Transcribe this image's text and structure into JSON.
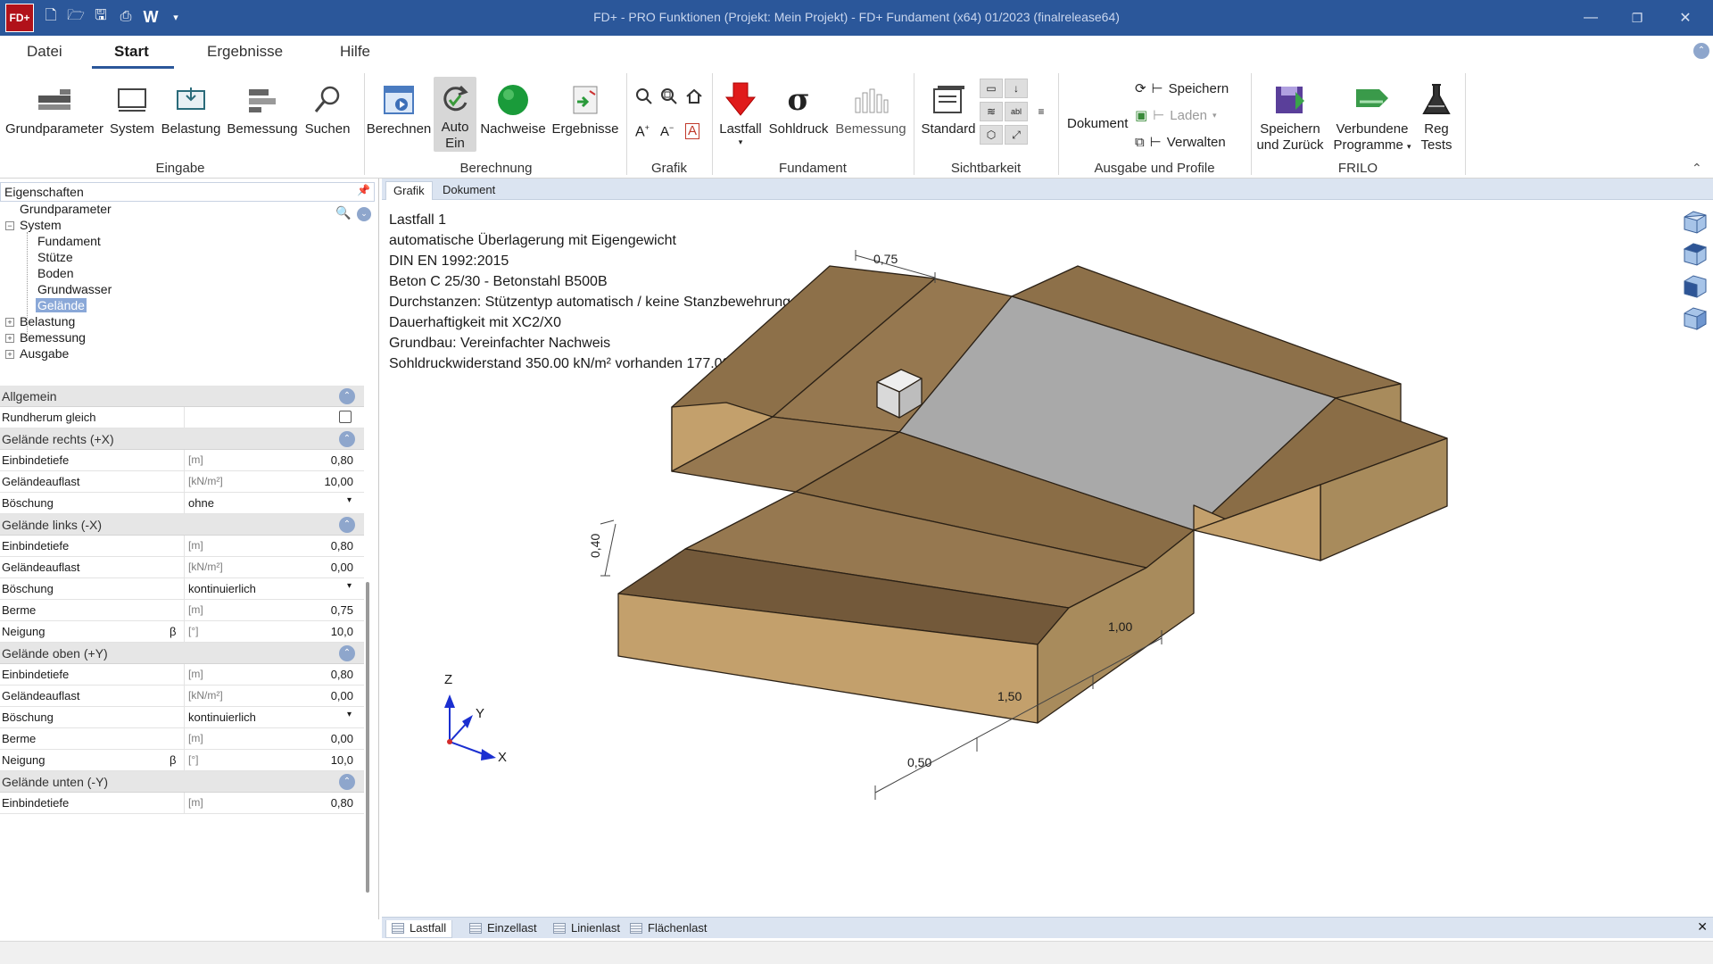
{
  "window": {
    "title": "FD+ - PRO Funktionen (Projekt: Mein Projekt) - FD+ Fundament (x64) 01/2023 (finalrelease64)",
    "logo": "FD+",
    "quick_access": [
      "new-file-icon",
      "open-folder-icon",
      "save-icon",
      "print-icon",
      "W",
      "dropdown"
    ]
  },
  "menu_tabs": [
    {
      "label": "Datei",
      "active": false
    },
    {
      "label": "Start",
      "active": true
    },
    {
      "label": "Ergebnisse",
      "active": false
    },
    {
      "label": "Hilfe",
      "active": false
    }
  ],
  "ribbon": {
    "eingabe": {
      "label": "Eingabe",
      "buttons": [
        "Grundparameter",
        "System",
        "Belastung",
        "Bemessung",
        "Suchen"
      ]
    },
    "berechnung": {
      "label": "Berechnung",
      "berechnen": "Berechnen",
      "auto_line1": "Auto",
      "auto_line2": "Ein",
      "nachweise": "Nachweise",
      "ergebnisse": "Ergebnisse"
    },
    "grafik": {
      "label": "Grafik"
    },
    "fundament": {
      "label": "Fundament",
      "buttons": [
        "Lastfall",
        "Sohldruck",
        "Bemessung"
      ]
    },
    "sichtbarkeit": {
      "label": "Sichtbarkeit",
      "standard": "Standard"
    },
    "ausgabe": {
      "label": "Ausgabe und Profile",
      "dokument": "Dokument",
      "speichern": "Speichern",
      "laden": "Laden",
      "verwalten": "Verwalten"
    },
    "frilo": {
      "label": "FRILO",
      "speichern_l1": "Speichern",
      "speichern_l2": "und Zurück",
      "verbundene_l1": "Verbundene",
      "verbundene_l2": "Programme",
      "reg_l1": "Reg",
      "reg_l2": "Tests"
    }
  },
  "left_panel": {
    "title": "Eigenschaften",
    "tree": [
      {
        "label": "Grundparameter",
        "level": 0
      },
      {
        "label": "System",
        "level": 0,
        "expander": "−"
      },
      {
        "label": "Fundament",
        "level": 1
      },
      {
        "label": "Stütze",
        "level": 1
      },
      {
        "label": "Boden",
        "level": 1
      },
      {
        "label": "Grundwasser",
        "level": 1
      },
      {
        "label": "Gelände",
        "level": 1,
        "selected": true
      },
      {
        "label": "Belastung",
        "level": 0,
        "expander": "+"
      },
      {
        "label": "Bemessung",
        "level": 0,
        "expander": "+"
      },
      {
        "label": "Ausgabe",
        "level": 0,
        "expander": "+"
      }
    ],
    "sections": {
      "allgemein": {
        "title": "Allgemein",
        "rundherum": "Rundherum gleich",
        "checked": false
      },
      "rechts": {
        "title": "Gelände rechts (+X)",
        "einbindetiefe": {
          "label": "Einbindetiefe",
          "unit": "[m]",
          "value": "0,80"
        },
        "auflast": {
          "label": "Geländeauflast",
          "unit": "[kN/m²]",
          "value": "10,00"
        },
        "boeschung": {
          "label": "Böschung",
          "value": "ohne"
        }
      },
      "links": {
        "title": "Gelände links (-X)",
        "einbindetiefe": {
          "label": "Einbindetiefe",
          "unit": "[m]",
          "value": "0,80"
        },
        "auflast": {
          "label": "Geländeauflast",
          "unit": "[kN/m²]",
          "value": "0,00"
        },
        "boeschung": {
          "label": "Böschung",
          "value": "kontinuierlich"
        },
        "berme": {
          "label": "Berme",
          "unit": "[m]",
          "value": "0,75"
        },
        "neigung": {
          "label": "Neigung",
          "symbol": "β",
          "unit": "[°]",
          "value": "10,0"
        }
      },
      "oben": {
        "title": "Gelände oben (+Y)",
        "einbindetiefe": {
          "label": "Einbindetiefe",
          "unit": "[m]",
          "value": "0,80"
        },
        "auflast": {
          "label": "Geländeauflast",
          "unit": "[kN/m²]",
          "value": "0,00"
        },
        "boeschung": {
          "label": "Böschung",
          "value": "kontinuierlich"
        },
        "berme": {
          "label": "Berme",
          "unit": "[m]",
          "value": "0,00"
        },
        "neigung": {
          "label": "Neigung",
          "symbol": "β",
          "unit": "[°]",
          "value": "10,0"
        }
      },
      "unten": {
        "title": "Gelände unten (-Y)",
        "einbindetiefe": {
          "label": "Einbindetiefe",
          "unit": "[m]",
          "value": "0,80"
        }
      }
    }
  },
  "graphic_tabs": [
    {
      "label": "Grafik",
      "active": true
    },
    {
      "label": "Dokument",
      "active": false
    }
  ],
  "graphic": {
    "info_lines": [
      "Lastfall 1",
      "automatische Überlagerung mit Eigengewicht",
      "DIN EN 1992:2015",
      "Beton C 25/30 - Betonstahl B500B",
      "Durchstanzen: Stützentyp automatisch / keine Stanzbewehrung",
      "Dauerhaftigkeit mit XC2/X0",
      "Grundbau: Vereinfachter Nachweis",
      "Sohldruckwiderstand 350.00 kN/m² vorhanden 177.00 kN/m²"
    ],
    "dimensions": {
      "top": "0,75",
      "left": "0,40",
      "d1": "1,00",
      "d2": "1,50",
      "d3": "0,50"
    },
    "axes": {
      "x": "X",
      "y": "Y",
      "z": "Z"
    },
    "colors": {
      "soil_side": "#c4a574",
      "soil_top": "#967850",
      "soil_dark": "#73593a",
      "foundation": "#a9a9a9",
      "column": "#d9d9d9",
      "accent": "#2b579a"
    }
  },
  "bottom_tabs": [
    {
      "label": "Lastfall",
      "active": true
    },
    {
      "label": "Einzellast",
      "active": false
    },
    {
      "label": "Linienlast",
      "active": false
    },
    {
      "label": "Flächenlast",
      "active": false
    }
  ]
}
